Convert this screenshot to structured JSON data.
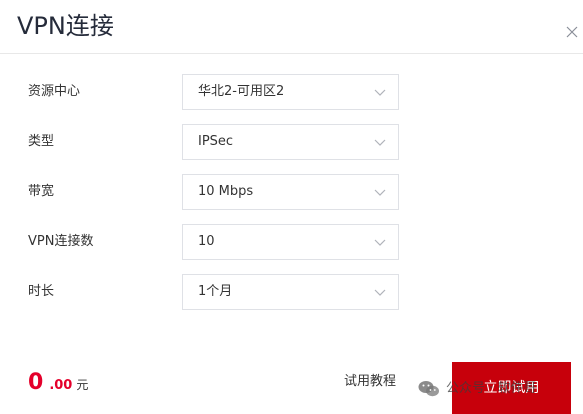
{
  "dialog": {
    "title": "VPN连接"
  },
  "fields": [
    {
      "label": "资源中心",
      "value": "华北2-可用区2"
    },
    {
      "label": "类型",
      "value": "IPSec"
    },
    {
      "label": "带宽",
      "value": "10 Mbps"
    },
    {
      "label": "VPN连接数",
      "value": "10"
    },
    {
      "label": "时长",
      "value": "1个月"
    }
  ],
  "footer": {
    "price_int": "0",
    "price_dec": ".00",
    "price_unit": "元",
    "tutorial_label": "试用教程",
    "trial_button_label": "立即试用"
  },
  "watermark": {
    "text": "公众号 · 软件哥"
  },
  "icons": {
    "close": "close-icon",
    "dropdown": "chevron-down-icon",
    "watermark": "wechat-icon"
  },
  "colors": {
    "accent": "#c7000b",
    "price": "#e4002b",
    "border": "#dfe1e6"
  }
}
